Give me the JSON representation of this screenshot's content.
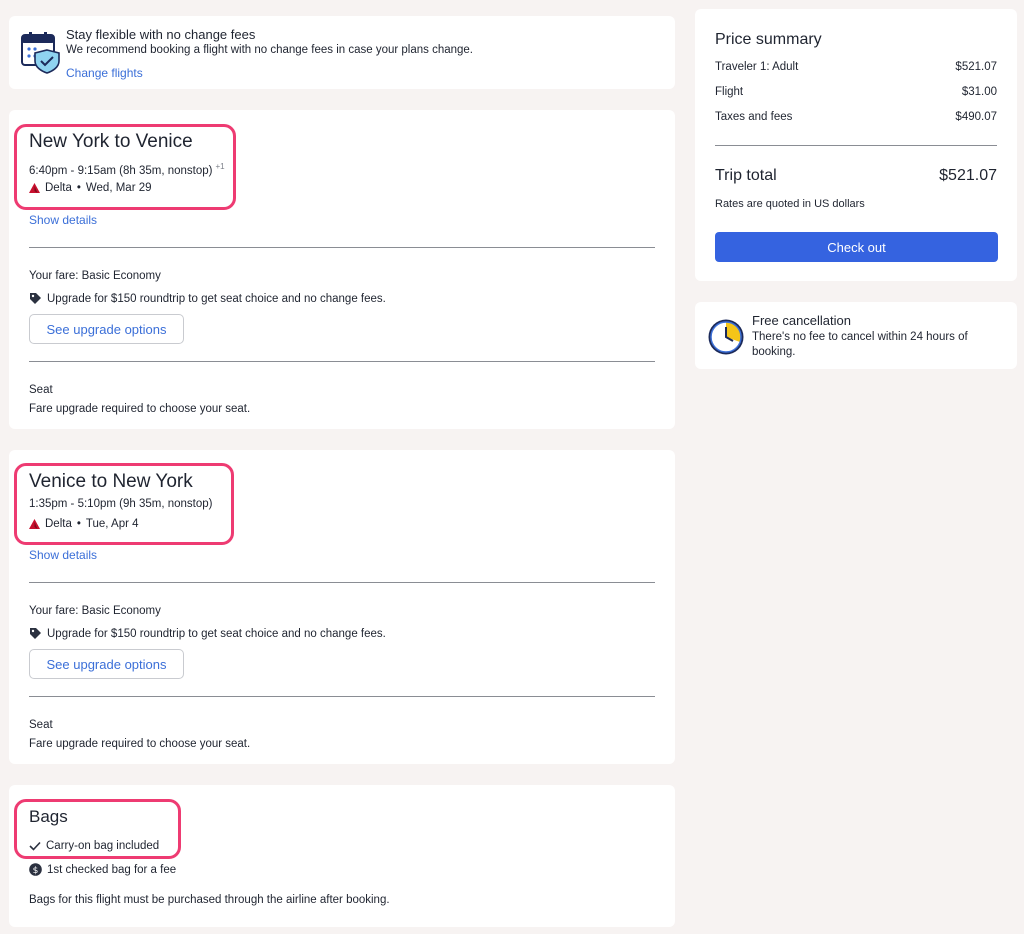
{
  "flex_banner": {
    "title": "Stay flexible with no change fees",
    "description": "We recommend booking a flight with no change fees in case your plans change.",
    "link": "Change flights",
    "icon": "calendar-shield-icon"
  },
  "flights": [
    {
      "route": "New York to Venice",
      "times": "6:40pm - 9:15am (8h 35m, nonstop)",
      "day_offset": "+1",
      "airline": "Delta",
      "date": "Wed, Mar 29",
      "show_details": "Show details",
      "fare": "Your fare: Basic Economy",
      "upgrade_text": "Upgrade for $150 roundtrip to get seat choice and no change fees.",
      "upgrade_button": "See upgrade options",
      "seat_label": "Seat",
      "seat_desc": "Fare upgrade required to choose your seat."
    },
    {
      "route": "Venice to New York",
      "times": "1:35pm - 5:10pm (9h 35m, nonstop)",
      "airline": "Delta",
      "date": "Tue, Apr 4",
      "show_details": "Show details",
      "fare": "Your fare: Basic Economy",
      "upgrade_text": "Upgrade for $150 roundtrip to get seat choice and no change fees.",
      "upgrade_button": "See upgrade options",
      "seat_label": "Seat",
      "seat_desc": "Fare upgrade required to choose your seat."
    }
  ],
  "bags": {
    "title": "Bags",
    "carry_on": "Carry-on bag included",
    "checked": "1st checked bag for a fee",
    "note": "Bags for this flight must be purchased through the airline after booking."
  },
  "price_summary": {
    "title": "Price summary",
    "rows": [
      {
        "label": "Traveler 1: Adult",
        "value": "$521.07"
      },
      {
        "label": "Flight",
        "value": "$31.00"
      },
      {
        "label": "Taxes and fees",
        "value": "$490.07"
      }
    ],
    "total_label": "Trip total",
    "total_value": "$521.07",
    "rates_note": "Rates are quoted in US dollars",
    "checkout_label": "Check out"
  },
  "cancellation": {
    "title": "Free cancellation",
    "description": "There's no fee to cancel within 24 hours of booking.",
    "icon": "clock-icon"
  },
  "colors": {
    "accent": "#3563e0",
    "link": "#3b6fd8",
    "highlight": "#ee3b72",
    "background": "#f7f3f2",
    "delta_red": "#c8102e"
  }
}
